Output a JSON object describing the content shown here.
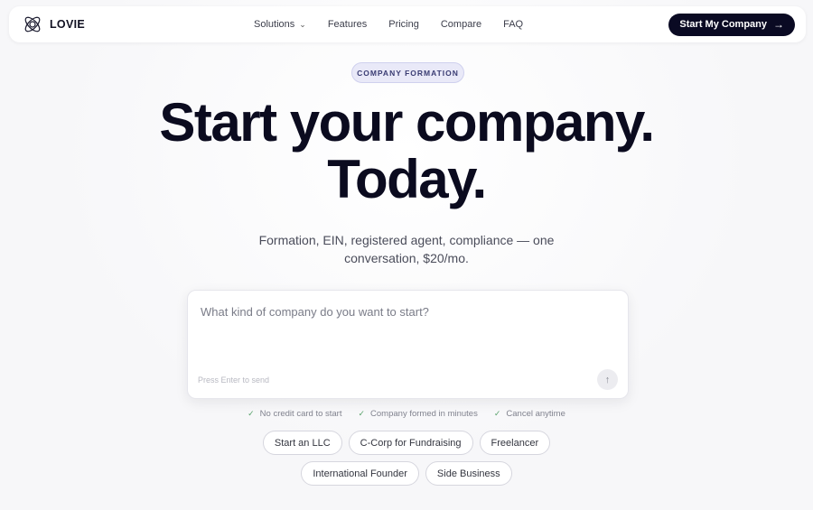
{
  "brand": {
    "name": "LOVIE"
  },
  "nav": {
    "links": [
      {
        "label": "Solutions",
        "has_dropdown": true
      },
      {
        "label": "Features"
      },
      {
        "label": "Pricing"
      },
      {
        "label": "Compare"
      },
      {
        "label": "FAQ"
      }
    ],
    "cta_label": "Start My Company"
  },
  "hero": {
    "badge": "COMPANY FORMATION",
    "title_line1": "Start your company.",
    "title_line2": "Today.",
    "subtitle": "Formation, EIN, registered agent, compliance — one conversation, $20/mo."
  },
  "prompt": {
    "placeholder": "What kind of company do you want to start?",
    "hint": "Press Enter to send"
  },
  "perks": [
    "No credit card to start",
    "Company formed in minutes",
    "Cancel anytime"
  ],
  "chips": [
    "Start an LLC",
    "C-Corp for Fundraising",
    "Freelancer",
    "International Founder",
    "Side Business"
  ],
  "colors": {
    "primary": "#0a0a23",
    "badge_bg": "#e9e9f8",
    "badge_text": "#3a3c73",
    "check": "#5aa36c"
  }
}
